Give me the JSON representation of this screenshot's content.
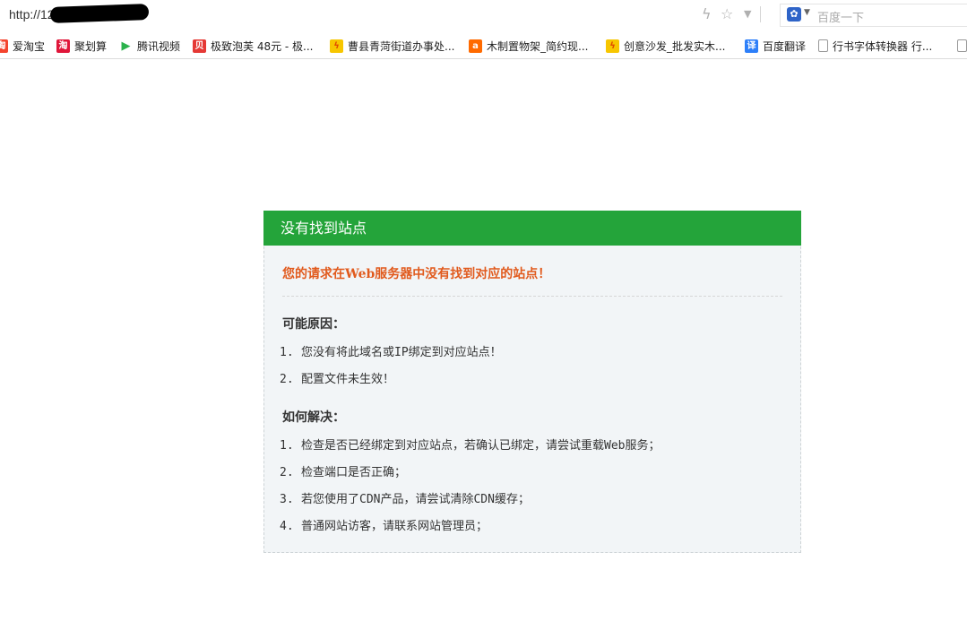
{
  "browser": {
    "url_prefix": "http://123.",
    "search_placeholder": "百度一下",
    "icons": [
      "lightning-icon",
      "star-icon",
      "dropdown-icon",
      "baidu-paw-icon"
    ]
  },
  "bookmarks": [
    {
      "label": "爱淘宝",
      "icon": "taobao-icon",
      "color": "#f4442e",
      "glyph": "淘"
    },
    {
      "label": "聚划算",
      "icon": "juhuasuan-icon",
      "color": "#e0163a",
      "glyph": "淘"
    },
    {
      "label": "腾讯视频",
      "icon": "tencent-video-icon",
      "color": "#ffffff",
      "glyph": "▶"
    },
    {
      "label": "极致泡芙 48元 - 极...",
      "icon": "beibei-icon",
      "color": "#e53935",
      "glyph": "贝"
    },
    {
      "label": "曹县青菏街道办事处...",
      "icon": "alibaba-icon",
      "color": "#f7c600",
      "glyph": "⚡"
    },
    {
      "label": "木制置物架_简约现...",
      "icon": "alibaba-icon",
      "color": "#ff6a00",
      "glyph": "a"
    },
    {
      "label": "创意沙发_批发实木...",
      "icon": "alibaba-icon",
      "color": "#f7c600",
      "glyph": "⚡"
    },
    {
      "label": "百度翻译",
      "icon": "baidu-translate-icon",
      "color": "#2d7ff9",
      "glyph": "译"
    },
    {
      "label": "行书字体转换器 行...",
      "icon": "page-icon",
      "color": "#ffffff",
      "glyph": ""
    }
  ],
  "error": {
    "title": "没有找到站点",
    "headline": "您的请求在Web服务器中没有找到对应的站点！",
    "reasons_title": "可能原因：",
    "reasons": [
      {
        "num": "1.",
        "text": "您没有将此域名或IP绑定到对应站点！"
      },
      {
        "num": "2.",
        "text": "配置文件未生效！"
      }
    ],
    "solutions_title": "如何解决：",
    "solutions": [
      {
        "num": "1.",
        "text": "检查是否已经绑定到对应站点，若确认已绑定，请尝试重载Web服务；"
      },
      {
        "num": "2.",
        "text": "检查端口是否正确；"
      },
      {
        "num": "3.",
        "text": "若您使用了CDN产品，请尝试清除CDN缓存；"
      },
      {
        "num": "4.",
        "text": "普通网站访客，请联系网站管理员；"
      }
    ],
    "colors": {
      "header": "#24a43a",
      "headline": "#e15a1d",
      "panel_bg": "#f2f5f7"
    }
  }
}
